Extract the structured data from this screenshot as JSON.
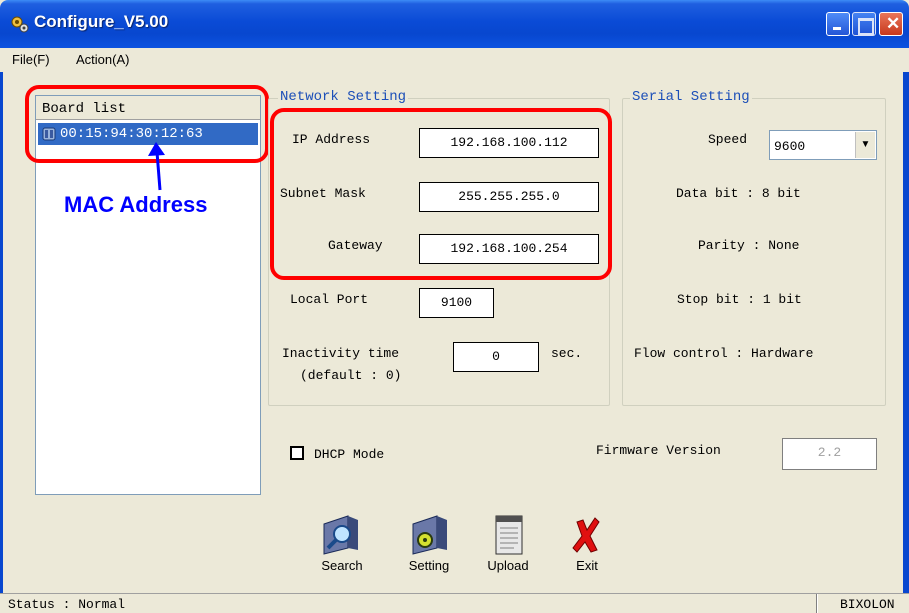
{
  "window": {
    "title": "Configure_V5.00"
  },
  "menu": [
    "File(F)",
    "Action(A)"
  ],
  "board_list": {
    "header": "Board list",
    "items": [
      "00:15:94:30:12:63"
    ]
  },
  "annotation": {
    "label": "MAC Address",
    "color": "#0000ff",
    "highlight_color": "#ff0000"
  },
  "network": {
    "title": "Network Setting",
    "ip_label": "IP Address",
    "ip_value": "192.168.100.112",
    "subnet_label": "Subnet Mask",
    "subnet_value": "255.255.255.0",
    "gateway_label": "Gateway",
    "gateway_value": "192.168.100.254",
    "local_port_label": "Local Port",
    "local_port_value": "9100",
    "inactivity_label": "Inactivity time",
    "inactivity_default": "(default : 0)",
    "inactivity_value": "0",
    "inactivity_unit": "sec."
  },
  "serial": {
    "title": "Serial Setting",
    "speed_label": "Speed",
    "speed_value": "9600",
    "data_bit": "Data bit : 8 bit",
    "parity": "Parity : None",
    "stop_bit": "Stop bit : 1 bit",
    "flow_control": "Flow control : Hardware"
  },
  "dhcp": {
    "label": "DHCP Mode",
    "checked": false
  },
  "firmware": {
    "label": "Firmware Version",
    "value": "2.2"
  },
  "toolbar": {
    "search": "Search",
    "setting": "Setting",
    "upload": "Upload",
    "exit": "Exit"
  },
  "status": {
    "text": "Status : Normal",
    "vendor": "BIXOLON"
  },
  "colors": {
    "titlebar": "#0a4bd6",
    "selection": "#316ac5",
    "group_title": "#1c4fb8"
  }
}
